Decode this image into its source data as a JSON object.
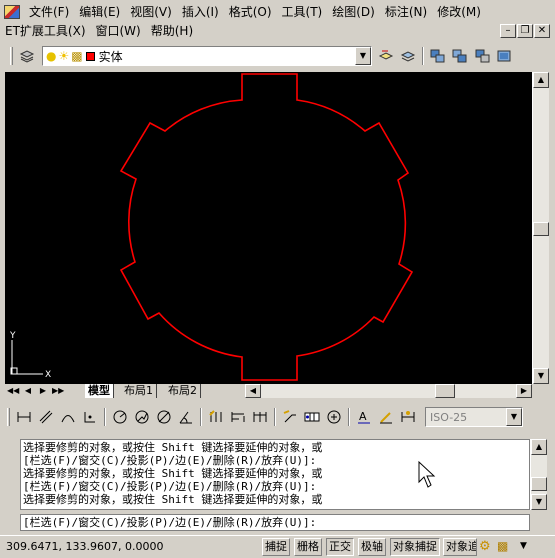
{
  "menu_row1": [
    "文件(F)",
    "编辑(E)",
    "视图(V)",
    "插入(I)",
    "格式(O)",
    "工具(T)",
    "绘图(D)",
    "标注(N)",
    "修改(M)"
  ],
  "menu_row2": [
    "ET扩展工具(X)",
    "窗口(W)",
    "帮助(H)"
  ],
  "layer_toolbar": {
    "current_layer": "实体"
  },
  "dim_style_value": "ISO-25",
  "layout_tabs": [
    "模型",
    "布局1",
    "布局2"
  ],
  "ucs_labels": {
    "x": "X",
    "y": "Y"
  },
  "command_history": [
    "选择要修剪的对象，或按住 Shift 键选择要延伸的对象，或",
    "[栏选(F)/窗交(C)/投影(P)/边(E)/删除(R)/放弃(U)]:",
    "选择要修剪的对象，或按住 Shift 键选择要延伸的对象，或",
    "[栏选(F)/窗交(C)/投影(P)/边(E)/删除(R)/放弃(U)]:",
    "选择要修剪的对象，或按住 Shift 键选择要延伸的对象，或"
  ],
  "command_prompt": "[栏选(F)/窗交(C)/投影(P)/边(E)/删除(R)/放弃(U)]:",
  "status": {
    "coordinates": "309.6471, 133.9607, 0.0000",
    "toggles": [
      "捕捉",
      "栅格",
      "正交",
      "极轴",
      "对象捕捉",
      "对象追"
    ]
  },
  "colors": {
    "drawing_background": "#000000",
    "shape_color": "#ff0000",
    "layer_swatch": "#ff0000",
    "ucs_icon": "#ffffff"
  }
}
